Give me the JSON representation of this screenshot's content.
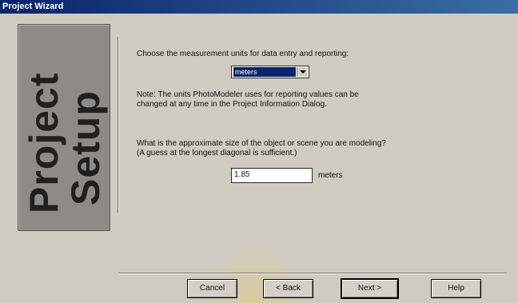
{
  "window": {
    "title": "Project Wizard"
  },
  "banner": {
    "line1": "Project",
    "line2": "Setup"
  },
  "units": {
    "prompt": "Choose the measurement units for data entry and reporting:",
    "selected": "meters",
    "note_line1": "Note: The units PhotoModeler uses for reporting values can be",
    "note_line2": "changed at any time in the Project Information Dialog."
  },
  "size": {
    "question_line1": "What is the approximate size of the object or scene you are modeling?",
    "question_line2": "(A guess at the longest diagonal is sufficient.)",
    "value": "1.85",
    "unit": "meters"
  },
  "buttons": {
    "cancel": "Cancel",
    "back": "< Back",
    "next": "Next >",
    "help": "Help"
  }
}
